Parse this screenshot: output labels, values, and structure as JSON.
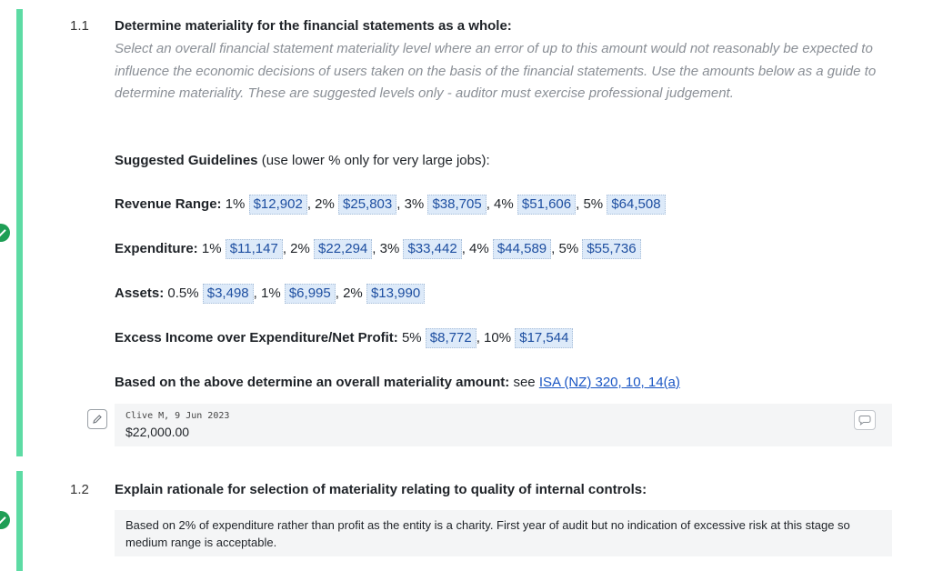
{
  "q1": {
    "number": "1.1",
    "title": "Determine materiality for the financial statements as a whole:",
    "description": "Select an overall financial statement materiality level where an error of up to this amount would not reasonably be expected to influence the economic decisions of users taken on the basis of the financial statements. Use the amounts below as a guide to determine materiality. These are suggested levels only - auditor must exercise professional judgement.",
    "guidelines_heading": "Suggested Guidelines",
    "guidelines_note": "(use lower % only for very large jobs):",
    "revenue": {
      "label": "Revenue Range:",
      "pcts": [
        "1%",
        "2%",
        "3%",
        "4%",
        "5%"
      ],
      "amounts": [
        "$12,902",
        "$25,803",
        "$38,705",
        "$51,606",
        "$64,508"
      ]
    },
    "expenditure": {
      "label": "Expenditure:",
      "pcts": [
        "1%",
        "2%",
        "3%",
        "4%",
        "5%"
      ],
      "amounts": [
        "$11,147",
        "$22,294",
        "$33,442",
        "$44,589",
        "$55,736"
      ]
    },
    "assets": {
      "label": "Assets:",
      "pcts": [
        "0.5%",
        "1%",
        "2%"
      ],
      "amounts": [
        "$3,498",
        "$6,995",
        "$13,990"
      ]
    },
    "profit": {
      "label": "Excess Income over Expenditure/Net Profit:",
      "pcts": [
        "5%",
        "10%"
      ],
      "amounts": [
        "$8,772",
        "$17,544"
      ]
    },
    "based_label": "Based on the above determine an overall materiality amount:",
    "see_text": "see",
    "isa_link": "ISA (NZ) 320, 10, 14(a)",
    "answer_meta": "Clive M, 9 Jun 2023",
    "answer_value": "$22,000.00"
  },
  "q2": {
    "number": "1.2",
    "title": "Explain rationale for selection of materiality relating to quality of internal controls:",
    "answer_text": "Based on 2% of expenditure rather than profit as the entity is a charity. First year of audit but no indication of excessive risk at this stage so medium range is acceptable."
  },
  "colors": {
    "accent_bar": "#5ddba4",
    "check": "#1e9e55",
    "amount_bg": "#ddeaf9",
    "link": "#1a56c4"
  },
  "icons": {
    "status": "check-circle-icon",
    "edit": "pencil-icon",
    "comment": "comment-icon"
  }
}
